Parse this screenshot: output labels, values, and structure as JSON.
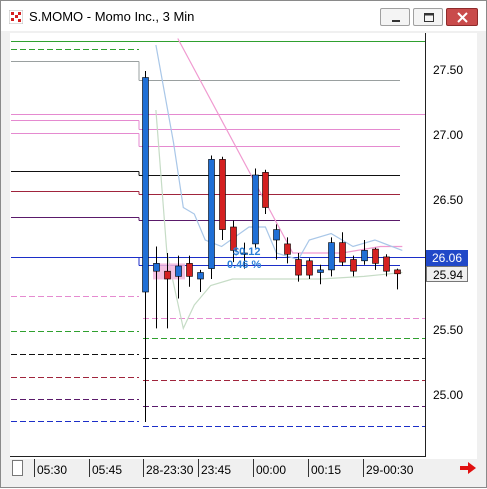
{
  "window": {
    "title": "S.MOMO - Momo Inc., 3 Min",
    "buttons": {
      "minimize": "minimize",
      "maximize": "maximize",
      "close": "close"
    }
  },
  "price_axis": {
    "labels": [
      "27.50",
      "27.00",
      "26.50",
      "26.00",
      "25.50",
      "25.00"
    ],
    "current_price": "26.06",
    "bid_price": "25.94",
    "current_color": "#2048c8"
  },
  "time_axis": {
    "labels": [
      "05:30",
      "05:45",
      "28-23:30",
      "23:45",
      "00:00",
      "00:15",
      "29-00:30"
    ]
  },
  "annotation": {
    "value": "$0.12",
    "percent": "0.46 %"
  },
  "chart_data": {
    "type": "candlestick",
    "timeframe": "3 Min",
    "ylim": [
      24.75,
      27.75
    ],
    "candles": [
      {
        "o": 25.8,
        "h": 27.5,
        "l": 24.8,
        "c": 27.45
      },
      {
        "o": 25.96,
        "h": 26.15,
        "l": 25.52,
        "c": 26.02
      },
      {
        "o": 25.96,
        "h": 26.1,
        "l": 25.52,
        "c": 25.9
      },
      {
        "o": 25.92,
        "h": 26.08,
        "l": 25.75,
        "c": 26.0
      },
      {
        "o": 26.02,
        "h": 26.08,
        "l": 25.84,
        "c": 25.92
      },
      {
        "o": 25.9,
        "h": 25.97,
        "l": 25.8,
        "c": 25.95
      },
      {
        "o": 25.98,
        "h": 26.85,
        "l": 25.9,
        "c": 26.82
      },
      {
        "o": 26.82,
        "h": 26.84,
        "l": 26.2,
        "c": 26.28
      },
      {
        "o": 26.3,
        "h": 26.35,
        "l": 26.03,
        "c": 26.12
      },
      {
        "o": 26.1,
        "h": 26.18,
        "l": 25.98,
        "c": 26.1
      },
      {
        "o": 26.17,
        "h": 26.75,
        "l": 26.14,
        "c": 26.7
      },
      {
        "o": 26.72,
        "h": 26.74,
        "l": 26.4,
        "c": 26.45
      },
      {
        "o": 26.2,
        "h": 26.32,
        "l": 26.05,
        "c": 26.28
      },
      {
        "o": 26.17,
        "h": 26.22,
        "l": 26.02,
        "c": 26.09
      },
      {
        "o": 26.05,
        "h": 26.1,
        "l": 25.88,
        "c": 25.93
      },
      {
        "o": 26.04,
        "h": 26.06,
        "l": 25.9,
        "c": 25.93
      },
      {
        "o": 25.95,
        "h": 26.01,
        "l": 25.86,
        "c": 25.97
      },
      {
        "o": 25.97,
        "h": 26.22,
        "l": 25.92,
        "c": 26.18
      },
      {
        "o": 26.18,
        "h": 26.26,
        "l": 26.0,
        "c": 26.03
      },
      {
        "o": 26.05,
        "h": 26.08,
        "l": 25.92,
        "c": 25.96
      },
      {
        "o": 26.04,
        "h": 26.2,
        "l": 26.01,
        "c": 26.12
      },
      {
        "o": 26.13,
        "h": 26.14,
        "l": 25.97,
        "c": 26.02
      },
      {
        "o": 26.07,
        "h": 26.09,
        "l": 25.92,
        "c": 25.96
      },
      {
        "o": 25.97,
        "h": 25.98,
        "l": 25.82,
        "c": 25.94
      }
    ],
    "up_color": "#1f6fd6",
    "down_color": "#d42020",
    "overlay_lines": [
      {
        "name": "",
        "color": "#f09ad0",
        "points": [
          [
            27.75,
            3
          ],
          [
            26.1,
            13.5
          ],
          [
            26.1,
            18
          ],
          [
            26.15,
            21.5
          ],
          [
            26.15,
            23.5
          ]
        ]
      },
      {
        "name": "",
        "color": "#a9c7e8",
        "points": [
          [
            27.7,
            1
          ],
          [
            26.95,
            2.6
          ],
          [
            26.45,
            3.5
          ],
          [
            26.4,
            4.5
          ],
          [
            26.2,
            5.5
          ],
          [
            26.15,
            7
          ],
          [
            26.3,
            9.5
          ],
          [
            26.3,
            11
          ],
          [
            26.1,
            12
          ],
          [
            26.05,
            14
          ],
          [
            26.2,
            15
          ],
          [
            26.25,
            17
          ],
          [
            26.15,
            19
          ],
          [
            26.2,
            21
          ],
          [
            26.12,
            23.5
          ]
        ]
      },
      {
        "name": "",
        "color": "#c6dcc6",
        "points": [
          [
            27.2,
            1
          ],
          [
            26.1,
            2
          ],
          [
            25.52,
            3.5
          ],
          [
            25.7,
            4.5
          ],
          [
            25.85,
            6
          ],
          [
            25.9,
            8
          ],
          [
            25.9,
            12
          ],
          [
            25.9,
            16
          ],
          [
            25.92,
            20
          ],
          [
            25.95,
            23.5
          ]
        ]
      }
    ],
    "horizontal_levels": [
      {
        "price": 27.73,
        "color": "#2fa02f",
        "style": "solid",
        "from": "full"
      },
      {
        "price": 27.67,
        "color": "#2fa02f",
        "style": "dash",
        "from": "left"
      },
      {
        "price": 27.58,
        "color": "#9aa0a0",
        "style": "solid",
        "from": "left",
        "step": 27.43
      },
      {
        "price": 27.17,
        "color": "#e58ad0",
        "style": "solid",
        "from": "full"
      },
      {
        "price": 27.12,
        "color": "#e58ad0",
        "style": "solid",
        "from": "left",
        "step": 27.05
      },
      {
        "price": 27.02,
        "color": "#e58ad0",
        "style": "solid",
        "from": "left",
        "step": 26.92
      },
      {
        "price": 26.73,
        "color": "#111111",
        "style": "solid",
        "from": "left",
        "step": 26.7
      },
      {
        "price": 26.58,
        "color": "#a0243c",
        "style": "solid",
        "from": "left",
        "step": 26.55
      },
      {
        "price": 26.38,
        "color": "#5a1a6a",
        "style": "solid",
        "from": "left",
        "step": 26.35
      },
      {
        "price": 26.07,
        "color": "#1c2ec8",
        "style": "solid",
        "from": "full",
        "step": 26.01
      },
      {
        "price": 25.77,
        "color": "#e58ad0",
        "style": "dash",
        "from": "left"
      },
      {
        "price": 25.6,
        "color": "#e58ad0",
        "style": "dash",
        "from": "right"
      },
      {
        "price": 25.5,
        "color": "#2fa02f",
        "style": "dash",
        "from": "left"
      },
      {
        "price": 25.45,
        "color": "#2fa02f",
        "style": "dash",
        "from": "right"
      },
      {
        "price": 25.32,
        "color": "#111111",
        "style": "dash",
        "from": "left"
      },
      {
        "price": 25.29,
        "color": "#111111",
        "style": "dash",
        "from": "right"
      },
      {
        "price": 25.15,
        "color": "#a0243c",
        "style": "dash",
        "from": "left"
      },
      {
        "price": 25.12,
        "color": "#a0243c",
        "style": "dash",
        "from": "right"
      },
      {
        "price": 24.98,
        "color": "#5a1a6a",
        "style": "dash",
        "from": "left"
      },
      {
        "price": 24.92,
        "color": "#5a1a6a",
        "style": "dash",
        "from": "right"
      },
      {
        "price": 24.81,
        "color": "#1c2ec8",
        "style": "dash",
        "from": "left"
      },
      {
        "price": 24.77,
        "color": "#1c2ec8",
        "style": "dash",
        "from": "right"
      }
    ]
  }
}
